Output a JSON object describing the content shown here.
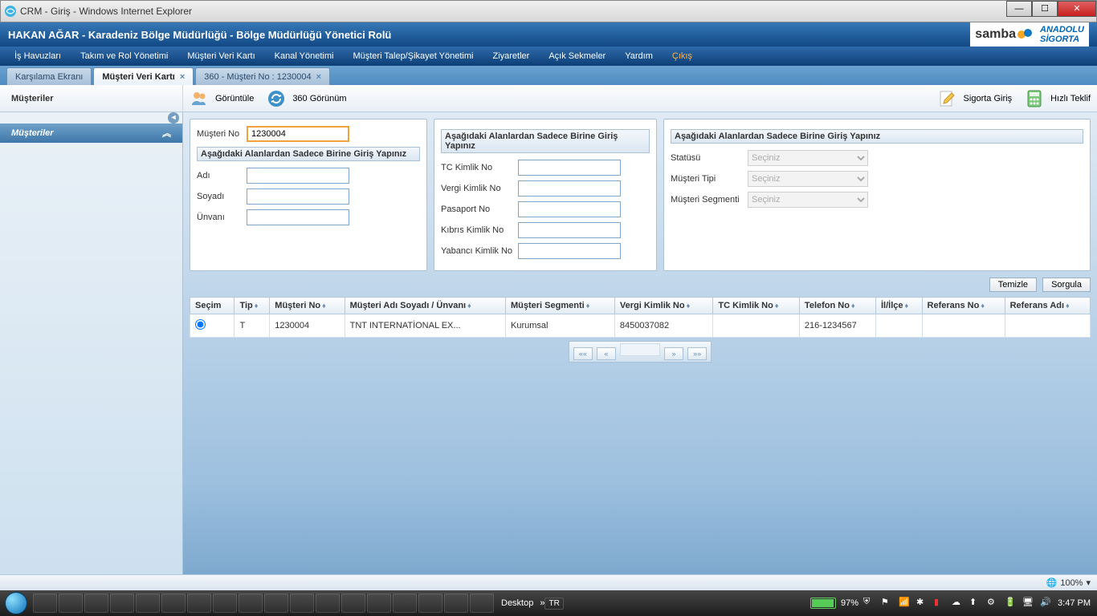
{
  "window": {
    "title": "CRM - Giriş - Windows Internet Explorer"
  },
  "header": {
    "user": "HAKAN AĞAR - Karadeniz Bölge Müdürlüğü - Bölge Müdürlüğü Yönetici Rolü",
    "logo1": "samba",
    "logo2_line1": "ANADOLU",
    "logo2_line2": "SİGORTA"
  },
  "menu": {
    "m1": "İş Havuzları",
    "m2": "Takım ve Rol Yönetimi",
    "m3": "Müşteri Veri Kartı",
    "m4": "Kanal Yönetimi",
    "m5": "Müşteri Talep/Şikayet Yönetimi",
    "m6": "Ziyaretler",
    "m7": "Açık Sekmeler",
    "m8": "Yardım",
    "m9": "Çıkış"
  },
  "tabs": {
    "t1": "Karşılama Ekranı",
    "t2": "Müşteri Veri Kartı",
    "t3": "360 - Müşteri No : 1230004"
  },
  "toolbar": {
    "section": "Müşteriler",
    "b1": "Görüntüle",
    "b2": "360 Görünüm",
    "b3": "Sigorta Giriş",
    "b4": "Hızlı Teklif"
  },
  "sidebar": {
    "header": "Müşteriler"
  },
  "panel_labels": {
    "musteri_no": "Müşteri No",
    "group_title": "Aşağıdaki Alanlardan Sadece Birine Giriş Yapınız",
    "adi": "Adı",
    "soyadi": "Soyadı",
    "unvani": "Ünvanı",
    "tc": "TC Kimlik No",
    "vergi": "Vergi Kimlik No",
    "pasaport": "Pasaport No",
    "kibris": "Kıbrıs Kimlik No",
    "yabanci": "Yabancı Kimlik No",
    "statusu": "Statüsü",
    "musteri_tipi": "Müşteri Tipi",
    "musteri_segmenti": "Müşteri Segmenti",
    "seciniz": "Seçiniz"
  },
  "values": {
    "musteri_no": "1230004"
  },
  "actions": {
    "temizle": "Temizle",
    "sorgula": "Sorgula"
  },
  "table": {
    "headers": {
      "secim": "Seçim",
      "tip": "Tip",
      "musteri_no": "Müşteri No",
      "ad": "Müşteri Adı Soyadı / Ünvanı",
      "segment": "Müşteri Segmenti",
      "vergi": "Vergi Kimlik No",
      "tc": "TC Kimlik No",
      "tel": "Telefon No",
      "il": "İl/İlçe",
      "ref_no": "Referans No",
      "ref_adi": "Referans Adı"
    },
    "row1": {
      "tip": "T",
      "musteri_no": "1230004",
      "ad": "TNT INTERNATİONAL EX...",
      "segment": "Kurumsal",
      "vergi": "8450037082",
      "tc": "",
      "tel": "216-1234567",
      "il": "",
      "ref_no": "",
      "ref_adi": ""
    }
  },
  "status": {
    "zoom": "100%"
  },
  "taskbar": {
    "desktop": "Desktop",
    "lang": "TR",
    "battery": "97%",
    "time": "3:47 PM"
  }
}
